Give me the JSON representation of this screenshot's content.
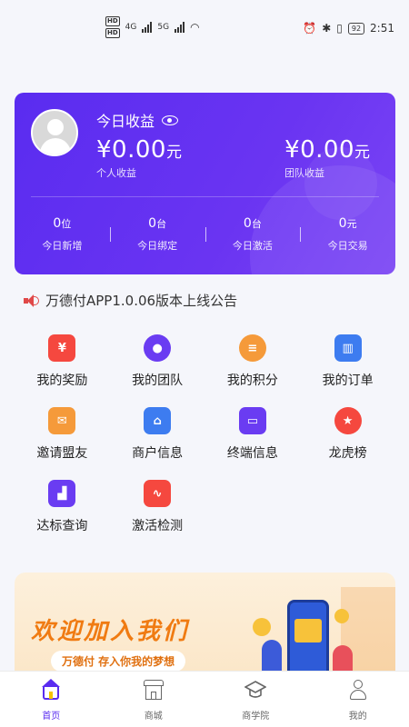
{
  "status_bar": {
    "time": "2:51",
    "battery": "92",
    "network_4g": "4G",
    "network_5g": "5G"
  },
  "earnings_card": {
    "title": "今日收益",
    "personal": {
      "amount": "¥0.00",
      "unit": "元",
      "label": "个人收益"
    },
    "team": {
      "amount": "¥0.00",
      "unit": "元",
      "label": "团队收益"
    },
    "stats": [
      {
        "value": "0",
        "unit": "位",
        "label": "今日新增"
      },
      {
        "value": "0",
        "unit": "台",
        "label": "今日绑定"
      },
      {
        "value": "0",
        "unit": "台",
        "label": "今日激活"
      },
      {
        "value": "0",
        "unit": "元",
        "label": "今日交易"
      }
    ]
  },
  "announcement": {
    "text": "万德付APP1.0.06版本上线公告"
  },
  "menu": [
    {
      "label": "我的奖励",
      "icon": "money-bag-icon",
      "color": "#f5483f"
    },
    {
      "label": "我的团队",
      "icon": "team-icon",
      "color": "#6a3cf2"
    },
    {
      "label": "我的积分",
      "icon": "coins-icon",
      "color": "#f59a3a"
    },
    {
      "label": "我的订单",
      "icon": "orders-chart-icon",
      "color": "#3d7cf0"
    },
    {
      "label": "邀请盟友",
      "icon": "envelope-icon",
      "color": "#f59a3a"
    },
    {
      "label": "商户信息",
      "icon": "store-icon",
      "color": "#3d7cf0"
    },
    {
      "label": "终端信息",
      "icon": "terminal-icon",
      "color": "#6a3cf2"
    },
    {
      "label": "龙虎榜",
      "icon": "medal-icon",
      "color": "#f5483f"
    },
    {
      "label": "达标查询",
      "icon": "bar-chart-icon",
      "color": "#6a3cf2"
    },
    {
      "label": "激活检测",
      "icon": "pulse-icon",
      "color": "#f5483f"
    }
  ],
  "banner": {
    "title": "欢迎加入我们",
    "subtitle": "万德付 存入你我的梦想"
  },
  "bottom_nav": [
    {
      "label": "首页",
      "icon": "home-icon",
      "active": true
    },
    {
      "label": "商城",
      "icon": "store-icon",
      "active": false
    },
    {
      "label": "商学院",
      "icon": "graduation-cap-icon",
      "active": false
    },
    {
      "label": "我的",
      "icon": "profile-icon",
      "active": false
    }
  ],
  "colors": {
    "primary": "#5a2cf0",
    "background": "#f5f6fb"
  }
}
